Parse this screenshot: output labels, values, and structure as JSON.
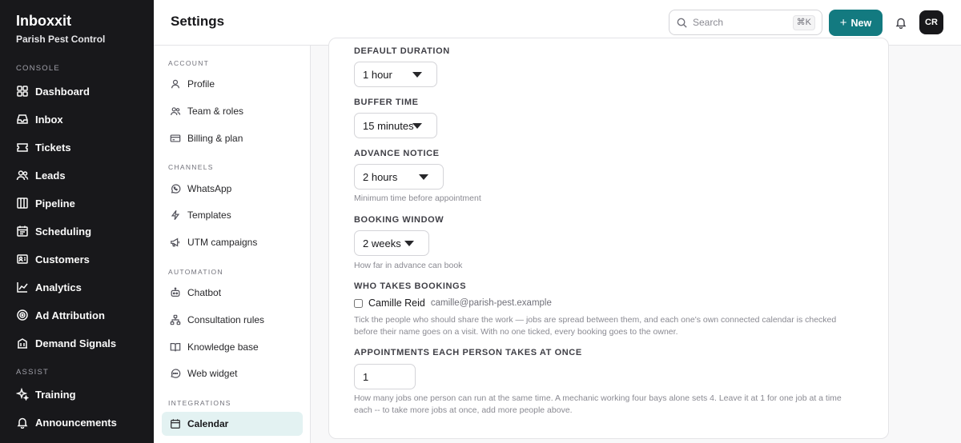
{
  "app": {
    "name": "Inboxxit",
    "org": "Parish Pest Control"
  },
  "sidebar": {
    "sections": [
      {
        "label": "CONSOLE"
      },
      {
        "label": "ASSIST"
      }
    ],
    "items": [
      {
        "label": "Dashboard",
        "icon": "dashboard-icon"
      },
      {
        "label": "Inbox",
        "icon": "inbox-icon"
      },
      {
        "label": "Tickets",
        "icon": "ticket-icon"
      },
      {
        "label": "Leads",
        "icon": "users-icon"
      },
      {
        "label": "Pipeline",
        "icon": "pipeline-icon"
      },
      {
        "label": "Scheduling",
        "icon": "calendar-icon"
      },
      {
        "label": "Customers",
        "icon": "id-card-icon"
      },
      {
        "label": "Analytics",
        "icon": "chart-line-icon"
      },
      {
        "label": "Ad Attribution",
        "icon": "target-icon"
      },
      {
        "label": "Demand Signals",
        "icon": "building-icon"
      },
      {
        "label": "Training",
        "icon": "sparkle-icon"
      },
      {
        "label": "Announcements",
        "icon": "bell-icon"
      }
    ]
  },
  "header": {
    "title": "Settings",
    "search_placeholder": "Search",
    "search_shortcut": "⌘K",
    "new_label": "New",
    "avatar_initials": "CR"
  },
  "settings_nav": {
    "sections": [
      {
        "label": "ACCOUNT"
      },
      {
        "label": "CHANNELS"
      },
      {
        "label": "AUTOMATION"
      },
      {
        "label": "INTEGRATIONS"
      }
    ],
    "items": [
      {
        "label": "Profile",
        "icon": "user-icon"
      },
      {
        "label": "Team & roles",
        "icon": "team-icon"
      },
      {
        "label": "Billing & plan",
        "icon": "credit-card-icon"
      },
      {
        "label": "WhatsApp",
        "icon": "whatsapp-icon"
      },
      {
        "label": "Templates",
        "icon": "lightning-icon"
      },
      {
        "label": "UTM campaigns",
        "icon": "megaphone-icon"
      },
      {
        "label": "Chatbot",
        "icon": "bot-icon"
      },
      {
        "label": "Consultation rules",
        "icon": "hierarchy-icon"
      },
      {
        "label": "Knowledge base",
        "icon": "book-icon"
      },
      {
        "label": "Web widget",
        "icon": "chat-icon"
      },
      {
        "label": "Calendar",
        "icon": "calendar-icon"
      }
    ],
    "active": "Calendar"
  },
  "form": {
    "default_duration": {
      "label": "DEFAULT DURATION",
      "value": "1 hour"
    },
    "buffer_time": {
      "label": "BUFFER TIME",
      "value": "15 minutes"
    },
    "advance_notice": {
      "label": "ADVANCE NOTICE",
      "value": "2 hours",
      "hint": "Minimum time before appointment"
    },
    "booking_window": {
      "label": "BOOKING WINDOW",
      "value": "2 weeks",
      "hint": "How far in advance can book"
    },
    "who_takes": {
      "label": "WHO TAKES BOOKINGS",
      "person_name": "Camille Reid",
      "person_email": "camille@parish-pest.example",
      "checked": false,
      "hint_line1": "Tick the people who should share the work — jobs are spread between them, and each one's own connected calendar is checked",
      "hint_line2": "before their name goes on a visit. With no one ticked, every booking goes to the owner."
    },
    "appointments_at_once": {
      "label": "APPOINTMENTS EACH PERSON TAKES AT ONCE",
      "value": "1",
      "hint_line1": "How many jobs one person can run at the same time. A mechanic working four bays alone sets 4. Leave it at 1 for one job at a time",
      "hint_line2": "each -- to take more jobs at once, add more people above."
    }
  }
}
